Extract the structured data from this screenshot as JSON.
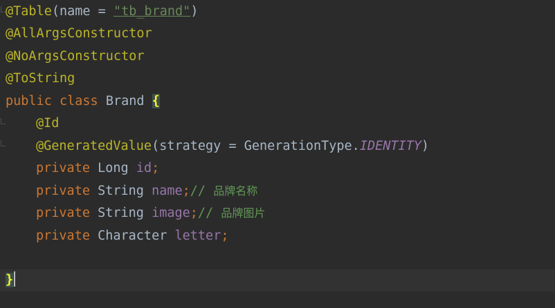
{
  "editor": {
    "lines": [
      {
        "annotation": "@Table",
        "open": "(",
        "param": "name = ",
        "string": "\"tb_brand\"",
        "close": ")"
      },
      {
        "annotation": "@AllArgsConstructor"
      },
      {
        "annotation": "@NoArgsConstructor"
      },
      {
        "annotation": "@ToString"
      },
      {
        "kw1": "public",
        "kw2": "class",
        "name": "Brand",
        "brace": "{"
      },
      {
        "annotation": "@Id"
      },
      {
        "annotation": "@GeneratedValue",
        "args_open": "(strategy = GenerationType.",
        "constant": "IDENTITY",
        "args_close": ")"
      },
      {
        "kw": "private",
        "type": "Long",
        "field": "id",
        "semi": ";"
      },
      {
        "kw": "private",
        "type": "String",
        "field": "name",
        "semi": ";",
        "comment_slash": "// ",
        "comment_text": "品牌名称"
      },
      {
        "kw": "private",
        "type": "String",
        "field": "image",
        "semi": ";",
        "comment_slash": "// ",
        "comment_text": "品牌图片"
      },
      {
        "kw": "private",
        "type": "Character",
        "field": "letter",
        "semi": ";"
      },
      {},
      {
        "brace": "}"
      }
    ]
  },
  "colors": {
    "background": "#2b2b2b",
    "annotation": "#bbb529",
    "keyword": "#cc7832",
    "string": "#6a8759",
    "field": "#9876aa",
    "comment": "#629755",
    "text": "#a9b7c6"
  }
}
